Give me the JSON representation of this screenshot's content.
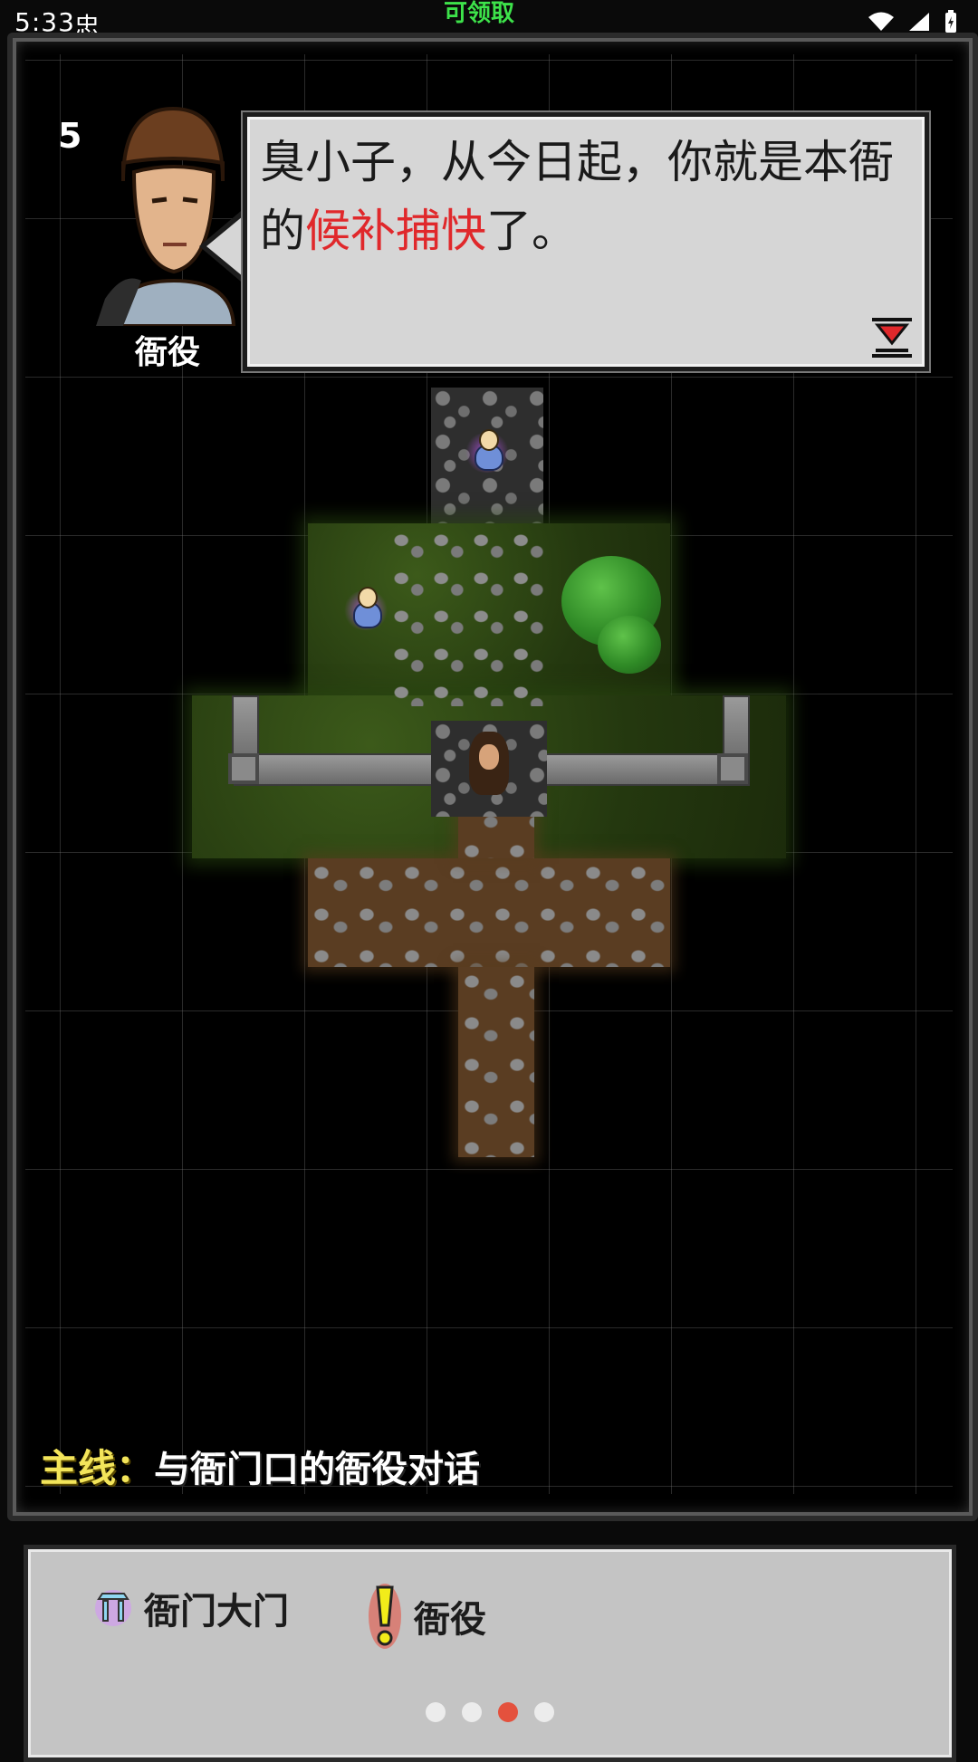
{
  "status_bar": {
    "time": "5:33",
    "app_glyph": "忠",
    "banner": "可领取",
    "icons": [
      "wifi-icon",
      "signal-icon",
      "battery-icon"
    ]
  },
  "dialogue": {
    "level": "5",
    "speaker": "衙役",
    "text_before": "臭小子，从今日起，你就是本衙的",
    "text_highlight": "候补捕快",
    "text_after": "了。"
  },
  "quest": {
    "label": "主线：",
    "text": "与衙门口的衙役对话"
  },
  "legend": [
    {
      "icon": "gate-icon",
      "label": "衙门大门",
      "color": "#b04ad8"
    },
    {
      "icon": "exclamation-icon",
      "label": "衙役",
      "color": "#e8e81a"
    }
  ],
  "pager": {
    "pages": 4,
    "active_page": 3
  },
  "colors": {
    "highlight": "#e0282b",
    "quest_label": "#f3e55a",
    "grass": "#2e4a14",
    "dirt": "#5a3d22",
    "banner_green": "#3de24a"
  }
}
